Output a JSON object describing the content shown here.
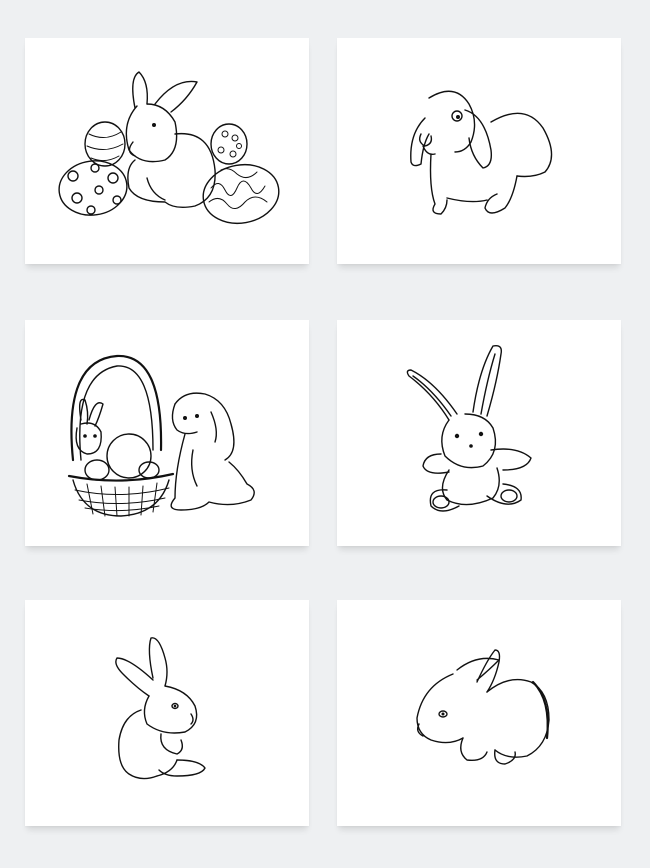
{
  "gallery": {
    "background_color": "#eef0f2",
    "card_color": "#ffffff",
    "stroke_color": "#111111",
    "items": [
      {
        "icon": "bunny-with-easter-eggs-icon"
      },
      {
        "icon": "lop-eared-bunny-icon"
      },
      {
        "icon": "bunny-with-easter-basket-icon"
      },
      {
        "icon": "plush-bunny-icon"
      },
      {
        "icon": "sitting-bunny-icon"
      },
      {
        "icon": "crouching-bunny-icon"
      }
    ]
  }
}
